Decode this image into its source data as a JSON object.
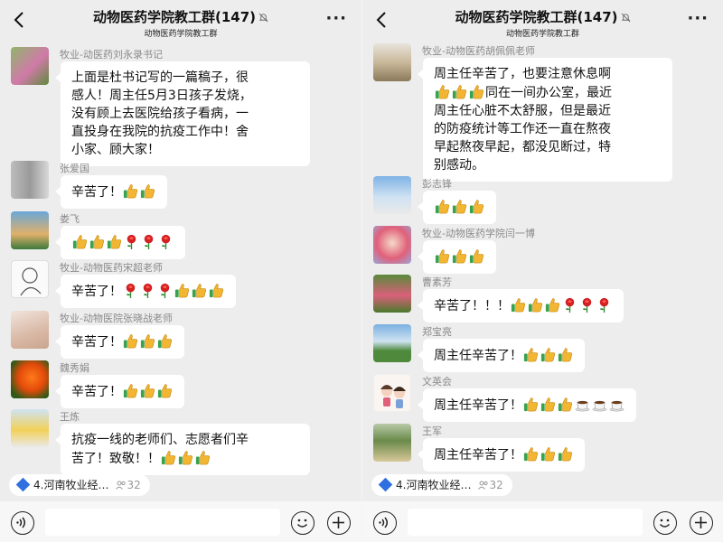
{
  "header": {
    "title": "动物医药学院教工群(147)",
    "subtitle": "动物医药学院教工群"
  },
  "left_messages": [
    {
      "sender": "牧业-动医药刘永录书记",
      "text": "上面是杜书记写的一篇稿子，很感人！周主任5月3日孩子发烧，没有顾上去医院给孩子看病，一直投身在我院的抗疫工作中！舍小家、顾大家！",
      "emojis": ""
    },
    {
      "sender": "张爱国",
      "text": "辛苦了！",
      "emojis": "thumbs,thumbs"
    },
    {
      "sender": "娄飞",
      "text": "",
      "emojis": "thumbs,thumbs,thumbs,rose,rose,rose"
    },
    {
      "sender": "牧业-动物医药宋超老师",
      "text": "辛苦了！",
      "emojis": "rose,rose,rose,thumbs,thumbs,thumbs"
    },
    {
      "sender": "牧业-动物医院张晓战老师",
      "text": "辛苦了！",
      "emojis": "thumbs,thumbs,thumbs"
    },
    {
      "sender": "魏秀娟",
      "text": "辛苦了！",
      "emojis": "thumbs,thumbs,thumbs"
    },
    {
      "sender": "王炼",
      "text": "抗疫一线的老师们、志愿者们辛苦了！致敬！！",
      "emojis": "thumbs,thumbs,thumbs"
    }
  ],
  "right_messages": [
    {
      "sender": "牧业-动物医药胡佩佩老师",
      "text": "周主任辛苦了，也要注意休息啊同在一间办公室，最近周主任心脏不太舒服，但是最近的防疫统计等工作还一直在熬夜早起熬夜早起，都没见断过，特别感动。",
      "emojis": ""
    },
    {
      "sender": "彭志锋",
      "text": "",
      "emojis": "thumbs,thumbs,thumbs"
    },
    {
      "sender": "牧业-动物医药学院闫一博",
      "text": "",
      "emojis": "thumbs,thumbs,thumbs"
    },
    {
      "sender": "曹素芳",
      "text": "辛苦了！！！",
      "emojis": "thumbs,thumbs,thumbs,rose,rose,rose"
    },
    {
      "sender": "郑宝亮",
      "text": "周主任辛苦了！",
      "emojis": "thumbs,thumbs,thumbs"
    },
    {
      "sender": "文英会",
      "text": "周主任辛苦了！",
      "emojis": "thumbs,thumbs,thumbs,coffee,coffee,coffee"
    },
    {
      "sender": "王军",
      "text": "周主任辛苦了！",
      "emojis": "thumbs,thumbs,thumbs"
    }
  ],
  "right_first_bubble": {
    "line1": "周主任辛苦了，也要注意休息啊",
    "line2_after_emoji": "同在一间办公室，最近",
    "line3": "周主任心脏不太舒服，但是最近",
    "line4": "的防疫统计等工作还一直在熬夜",
    "line5": "早起熬夜早起，都没见断过，特",
    "line6": "别感动。"
  },
  "left_first_bubble": {
    "line1": "上面是杜书记写的一篇稿子，很",
    "line2": "感人！周主任5月3日孩子发烧，",
    "line3": "没有顾上去医院给孩子看病，一",
    "line4": "直投身在我院的抗疫工作中！舍",
    "line5": "小家、顾大家！"
  },
  "left_last_bubble": {
    "line1": "抗疫一线的老师们、志愿者们辛",
    "line2": "苦了！致敬！！"
  },
  "bottom_card": {
    "label": "4.河南牧业经…",
    "count": "32"
  },
  "icons": {
    "back": "chevron-left-icon",
    "mute": "bell-off-icon",
    "more": "more-dots-icon",
    "voice": "voice-icon",
    "emoji": "emoji-icon",
    "add": "plus-icon"
  },
  "colors": {
    "chat_bg": "#ededed",
    "bubble_bg": "#ffffff",
    "thumbs": "#f2b632",
    "rose": "#d32020"
  }
}
